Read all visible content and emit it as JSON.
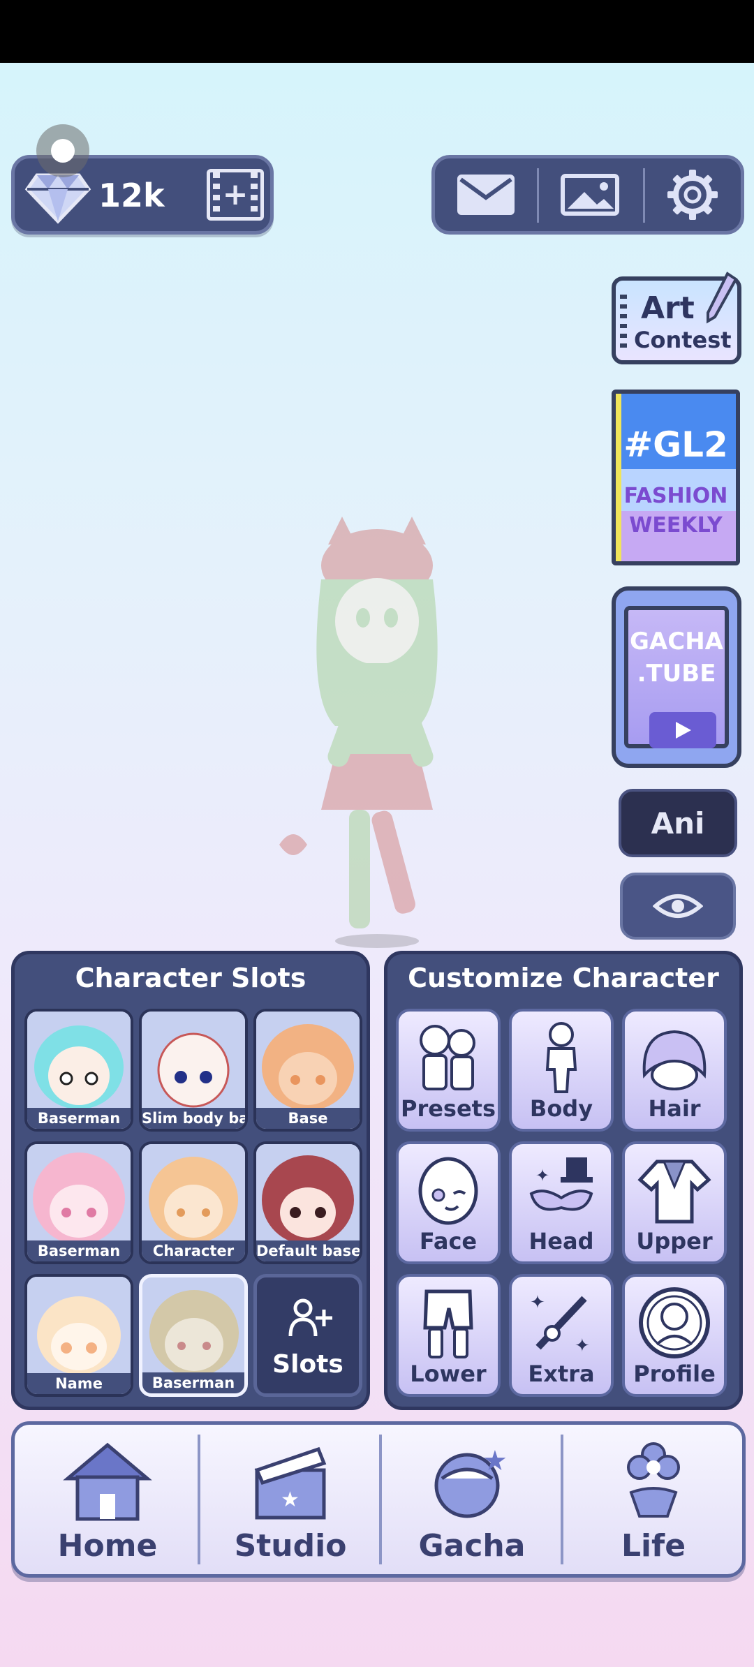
{
  "top_bar": {
    "gem_count": "12k"
  },
  "promos": {
    "art_contest_line1": "Art",
    "art_contest_line2": "Contest",
    "gl2_tag": "#GL2",
    "gl2_line1": "FASHION",
    "gl2_line2": "WEEKLY",
    "gacha_tube_line1": "GACHA",
    "gacha_tube_line2": ".TUBE",
    "ani_label": "Ani"
  },
  "character_slots": {
    "title": "Character Slots",
    "slots": [
      {
        "name": "Baserman"
      },
      {
        "name": "Slim body bas"
      },
      {
        "name": "Base"
      },
      {
        "name": "Baserman"
      },
      {
        "name": "Character"
      },
      {
        "name": "Default base"
      },
      {
        "name": "Name"
      },
      {
        "name": "Baserman"
      }
    ],
    "add_label": "Slots"
  },
  "customize": {
    "title": "Customize Character",
    "buttons": [
      {
        "label": "Presets"
      },
      {
        "label": "Body"
      },
      {
        "label": "Hair"
      },
      {
        "label": "Face"
      },
      {
        "label": "Head"
      },
      {
        "label": "Upper"
      },
      {
        "label": "Lower"
      },
      {
        "label": "Extra"
      },
      {
        "label": "Profile"
      }
    ]
  },
  "nav": {
    "items": [
      {
        "label": "Home"
      },
      {
        "label": "Studio"
      },
      {
        "label": "Gacha"
      },
      {
        "label": "Life"
      }
    ]
  },
  "colors": {
    "panel": "#434f7c",
    "panel_border": "#2f3760",
    "accent_light": "#e6e8f6"
  }
}
